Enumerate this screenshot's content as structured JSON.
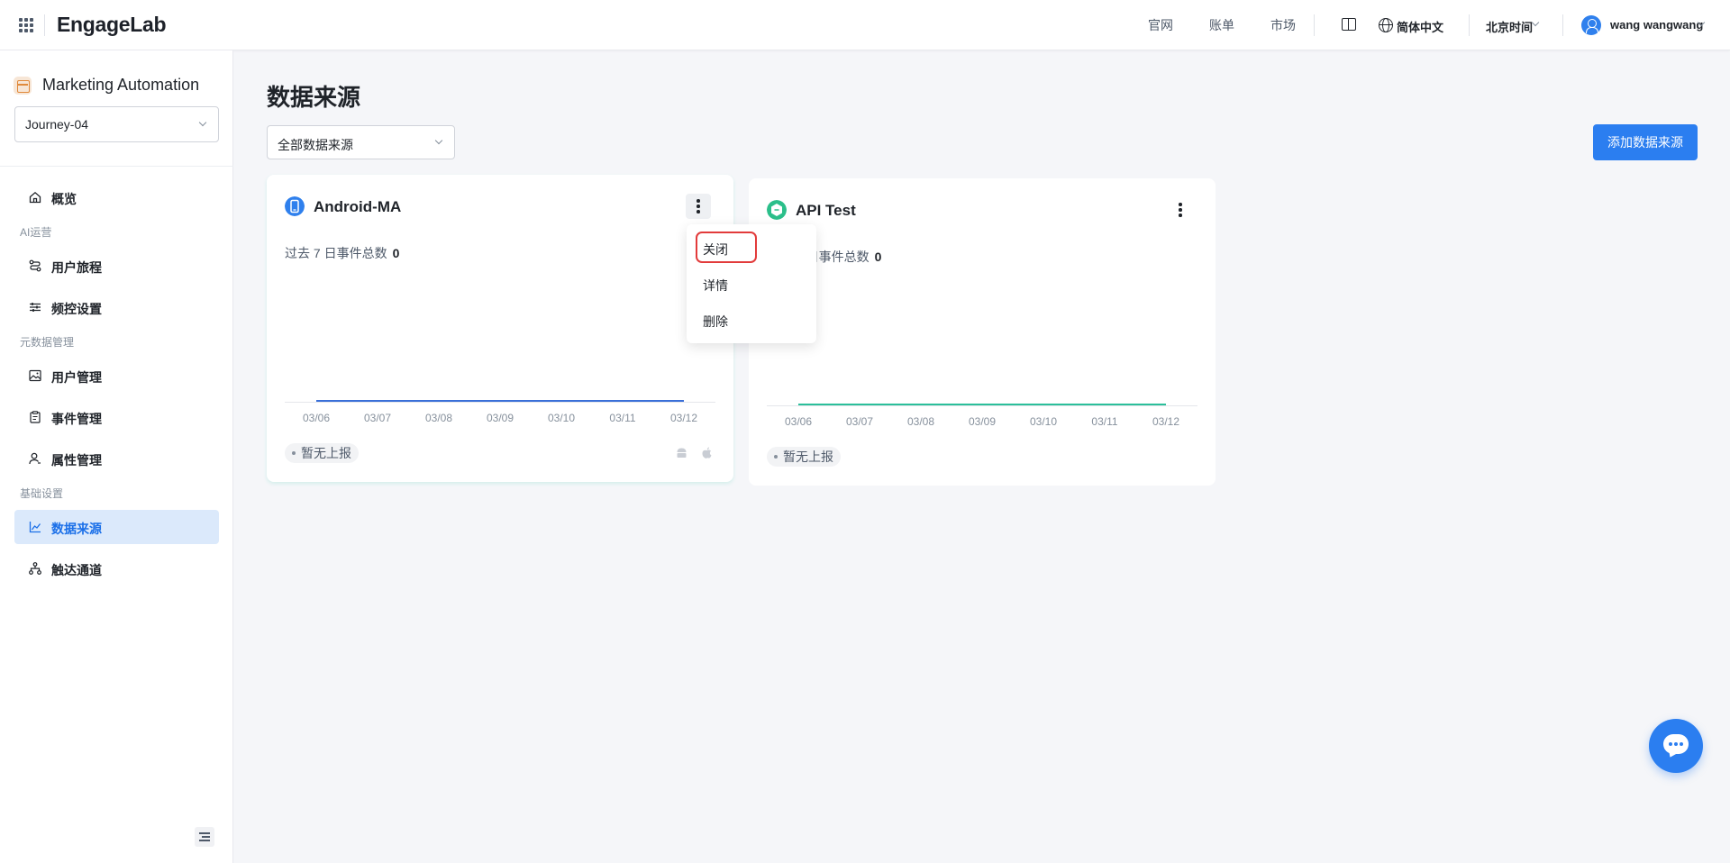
{
  "header": {
    "logo": "EngageLab",
    "nav": [
      "官网",
      "账单",
      "市场"
    ],
    "language": "简体中文",
    "timezone": "北京时间",
    "user_name": "wang wangwang"
  },
  "sidebar": {
    "app_title": "Marketing Automation",
    "project": "Journey-04",
    "items": [
      {
        "label": "概览",
        "icon": "home-icon"
      },
      {
        "group": "AI运营"
      },
      {
        "label": "用户旅程",
        "icon": "journey-icon"
      },
      {
        "label": "频控设置",
        "icon": "sliders-icon"
      },
      {
        "group": "元数据管理"
      },
      {
        "label": "用户管理",
        "icon": "image-icon"
      },
      {
        "label": "事件管理",
        "icon": "clipboard-icon"
      },
      {
        "label": "属性管理",
        "icon": "user-icon"
      },
      {
        "group": "基础设置"
      },
      {
        "label": "数据来源",
        "icon": "chart-line-icon",
        "active": true
      },
      {
        "label": "触达通道",
        "icon": "sitemap-icon"
      }
    ]
  },
  "main": {
    "title": "数据来源",
    "filter": "全部数据来源",
    "add_button": "添加数据来源"
  },
  "cards": [
    {
      "title": "Android-MA",
      "stat_label": "过去 7 日事件总数",
      "stat_value": "0",
      "status": "暂无上报",
      "icon_color": "#2f80ed",
      "line_color": "#3a6fd8"
    },
    {
      "title": "API Test",
      "stat_label": "过去 7 日事件总数",
      "stat_value": "0",
      "status": "暂无上报",
      "icon_color": "#2bbf8a",
      "line_color": "#2bbf9a"
    }
  ],
  "chart_data": [
    {
      "type": "line",
      "title": "Android-MA",
      "x": [
        "03/06",
        "03/07",
        "03/08",
        "03/09",
        "03/10",
        "03/11",
        "03/12"
      ],
      "series": [
        {
          "values": [
            0,
            0,
            0,
            0,
            0,
            0,
            0
          ]
        }
      ],
      "grid": false
    },
    {
      "type": "line",
      "title": "API Test",
      "x": [
        "03/06",
        "03/07",
        "03/08",
        "03/09",
        "03/10",
        "03/11",
        "03/12"
      ],
      "series": [
        {
          "values": [
            0,
            0,
            0,
            0,
            0,
            0,
            0
          ]
        }
      ],
      "grid": false
    }
  ],
  "dropdown": {
    "items": [
      "关闭",
      "详情",
      "删除"
    ],
    "highlighted": "关闭",
    "highlight_color": "#e23b3b"
  },
  "colors": {
    "accent": "#2b7ef0",
    "active_bg": "#dbe9fb"
  }
}
